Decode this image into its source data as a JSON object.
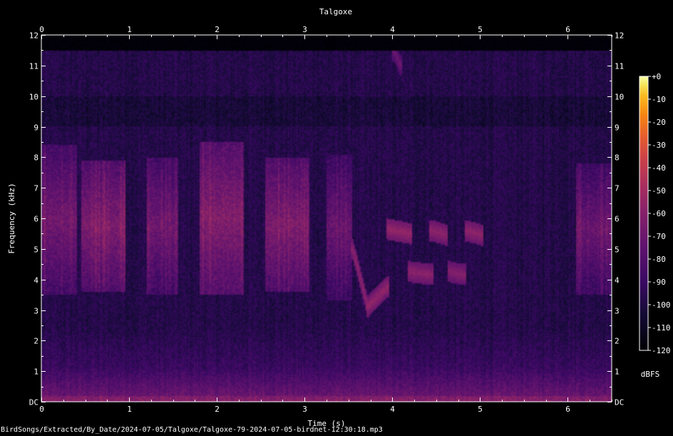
{
  "chart_data": {
    "type": "heatmap",
    "title": "Talgoxe",
    "xlabel": "Time (s)",
    "ylabel": "Frequency (kHz)",
    "xlim": [
      0,
      6.5
    ],
    "ylim": [
      0,
      12
    ],
    "x_ticks": [
      "0",
      "1",
      "2",
      "3",
      "4",
      "5",
      "6"
    ],
    "y_ticks": [
      "DC",
      "1",
      "2",
      "3",
      "4",
      "5",
      "6",
      "7",
      "8",
      "9",
      "10",
      "11",
      "12"
    ],
    "colorbar": {
      "label": "dBFS",
      "range": [
        -120,
        0
      ],
      "ticks": [
        "+0",
        "-10",
        "-20",
        "-30",
        "-40",
        "-50",
        "-60",
        "-70",
        "-80",
        "-90",
        "-100",
        "-110",
        "-120"
      ]
    },
    "signal_cutoff_khz": 11.5,
    "energy_blocks": [
      {
        "t0": 0.0,
        "t1": 0.4,
        "f0": 3.5,
        "f1": 8.4,
        "db": -68
      },
      {
        "t0": 0.45,
        "t1": 0.95,
        "f0": 3.6,
        "f1": 7.9,
        "db": -64
      },
      {
        "t0": 1.2,
        "t1": 1.55,
        "f0": 3.5,
        "f1": 8.0,
        "db": -70
      },
      {
        "t0": 1.8,
        "t1": 2.3,
        "f0": 3.5,
        "f1": 8.5,
        "db": -62
      },
      {
        "t0": 2.55,
        "t1": 3.05,
        "f0": 3.6,
        "f1": 8.0,
        "db": -64
      },
      {
        "t0": 3.25,
        "t1": 3.55,
        "f0": 3.3,
        "f1": 8.1,
        "db": -72
      },
      {
        "t0": 6.1,
        "t1": 6.5,
        "f0": 3.5,
        "f1": 7.8,
        "db": -72
      }
    ],
    "tonal_marks": [
      {
        "t0": 3.55,
        "t1": 3.72,
        "f0": 5.0,
        "f1": 3.1,
        "db": -58
      },
      {
        "t0": 3.72,
        "t1": 3.95,
        "f0": 3.1,
        "f1": 3.75,
        "db": -56
      },
      {
        "t0": 3.95,
        "t1": 4.2,
        "f0": 5.65,
        "f1": 5.5,
        "db": -55
      },
      {
        "t0": 4.45,
        "t1": 4.62,
        "f0": 5.6,
        "f1": 5.45,
        "db": -57
      },
      {
        "t0": 4.85,
        "t1": 5.02,
        "f0": 5.6,
        "f1": 5.45,
        "db": -57
      },
      {
        "t0": 4.2,
        "t1": 4.45,
        "f0": 4.25,
        "f1": 4.15,
        "db": -58
      },
      {
        "t0": 4.65,
        "t1": 4.82,
        "f0": 4.25,
        "f1": 4.15,
        "db": -60
      },
      {
        "t0": 4.02,
        "t1": 4.1,
        "f0": 11.5,
        "f1": 11.0,
        "db": -70
      }
    ]
  },
  "footer": {
    "path": "BirdSongs/Extracted/By_Date/2024-07-05/Talgoxe/Talgoxe-79-2024-07-05-birdnet-12:30:18.mp3"
  }
}
